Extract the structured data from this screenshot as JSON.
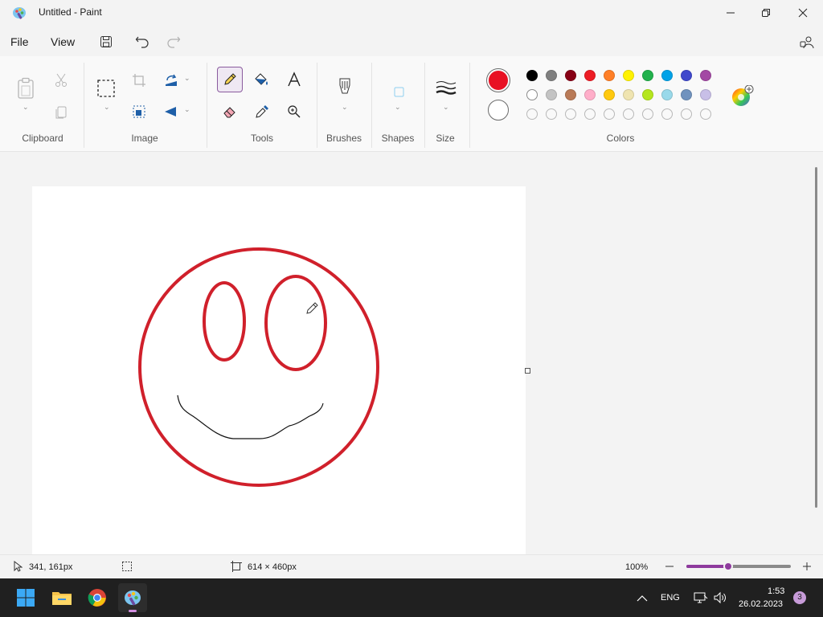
{
  "window": {
    "title": "Untitled - Paint"
  },
  "menu": {
    "file": "File",
    "view": "View"
  },
  "ribbon": {
    "groups": {
      "clipboard": "Clipboard",
      "image": "Image",
      "tools": "Tools",
      "brushes": "Brushes",
      "shapes": "Shapes",
      "size": "Size",
      "colors": "Colors"
    },
    "selected_tool": "pencil",
    "primary_color": "#e81123",
    "secondary_color": "#ffffff",
    "palette_row1": [
      "#000000",
      "#7f7f7f",
      "#880015",
      "#ed1c24",
      "#ff7f27",
      "#fff200",
      "#22b14c",
      "#00a2e8",
      "#3f48cc",
      "#a349a4"
    ],
    "palette_row2": [
      "#ffffff",
      "#c3c3c3",
      "#b97a57",
      "#ffaec9",
      "#ffc90e",
      "#efe4b0",
      "#b5e61d",
      "#99d9ea",
      "#7092be",
      "#c8bfe7"
    ],
    "palette_row3_empty": 10
  },
  "canvas": {
    "drawing_colors": {
      "outline": "#d0202b",
      "mouth": "#111111"
    }
  },
  "status": {
    "cursor_pos": "341, 161px",
    "canvas_size": "614 × 460px",
    "zoom": "100%",
    "zoom_level": 0.4
  },
  "taskbar": {
    "language": "ENG",
    "time": "1:53",
    "date": "26.02.2023",
    "notifications": "3"
  }
}
